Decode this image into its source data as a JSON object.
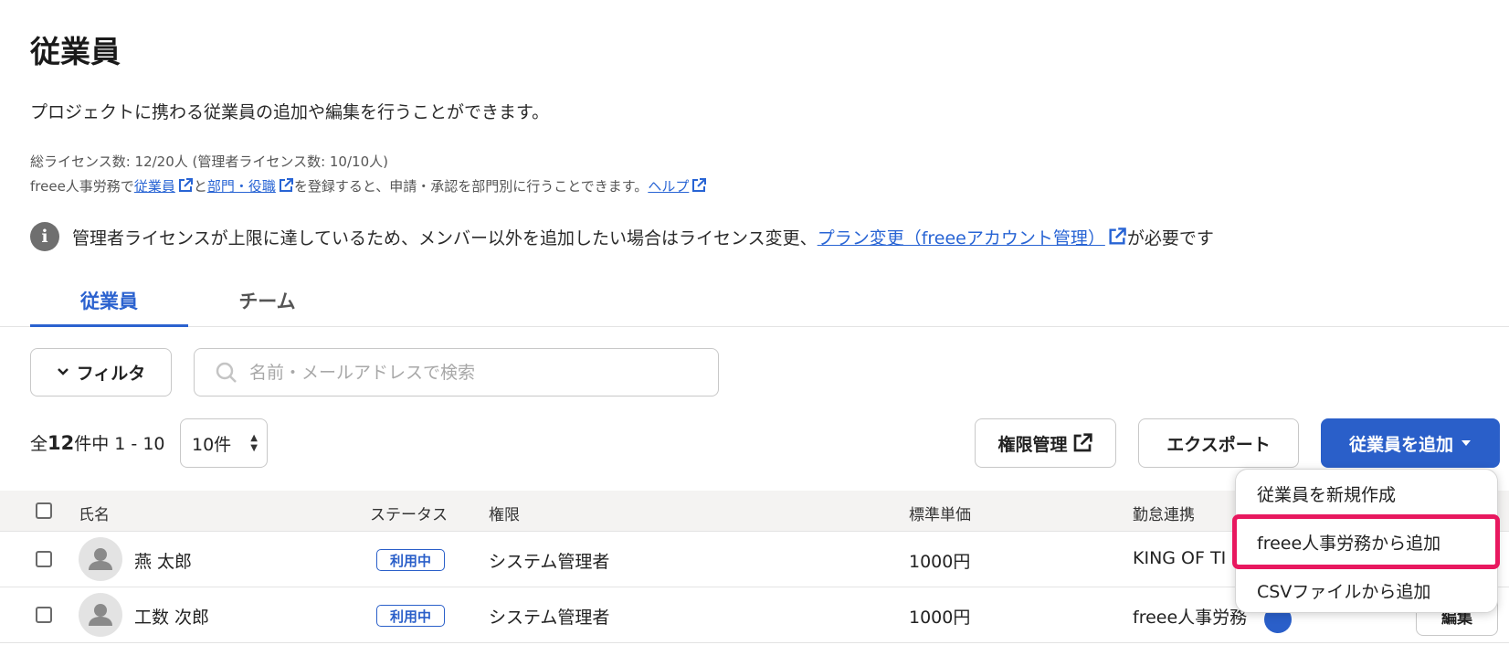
{
  "page": {
    "title": "従業員",
    "description": "プロジェクトに携わる従業員の追加や編集を行うことができます。",
    "license_text": "総ライセンス数: 12/20人 (管理者ライセンス数: 10/10人)",
    "hr_line": {
      "prefix": "freee人事労務で",
      "link_employee": "従業員",
      "mid1": "と",
      "link_department": "部門・役職",
      "mid2": "を登録すると、申請・承認を部門別に行うことできます。",
      "link_help": "ヘルプ"
    },
    "notice": {
      "text": "管理者ライセンスが上限に達しているため、メンバー以外を追加したい場合はライセンス変更、",
      "link": "プラン変更（freeeアカウント管理）",
      "suffix": "が必要です"
    }
  },
  "tabs": [
    {
      "label": "従業員",
      "active": true
    },
    {
      "label": "チーム",
      "active": false
    }
  ],
  "filters": {
    "filter_label": "フィルタ",
    "search_placeholder": "名前・メールアドレスで検索"
  },
  "pagination": {
    "prefix": "全",
    "total": "12",
    "suffix": "件中 1 - 10",
    "per_page": "10件"
  },
  "actions": {
    "permissions": "権限管理",
    "export": "エクスポート",
    "add_employee": "従業員を追加"
  },
  "table": {
    "columns": [
      "氏名",
      "ステータス",
      "権限",
      "標準単価",
      "勤怠連携"
    ],
    "rows": [
      {
        "name": "燕 太郎",
        "status": "利用中",
        "role": "システム管理者",
        "price": "1000円",
        "attendance": "KING OF TI"
      },
      {
        "name": "工数 次郎",
        "status": "利用中",
        "role": "システム管理者",
        "price": "1000円",
        "attendance": "freee人事労務"
      }
    ],
    "edit_label": "編集"
  },
  "dropdown": {
    "items": [
      "従業員を新規作成",
      "freee人事労務から追加",
      "CSVファイルから追加"
    ],
    "highlighted_index": 1
  },
  "colors": {
    "primary": "#2a5fc9",
    "link": "#2864d4",
    "highlight": "#e8185f"
  }
}
